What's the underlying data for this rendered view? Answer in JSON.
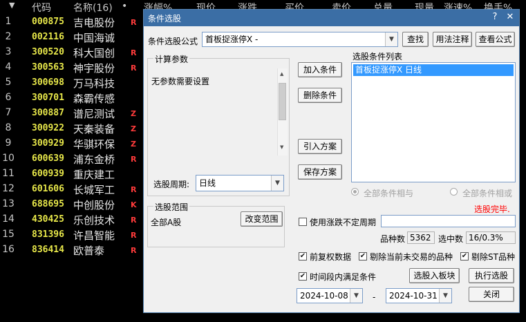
{
  "table": {
    "sort_icon": "▼",
    "headers": [
      "代码",
      "名称(16)",
      "•",
      "涨幅%",
      "现价",
      "涨跌",
      "买价",
      "卖价",
      "总量",
      "现量",
      "涨速%",
      "换手%"
    ],
    "rows": [
      {
        "idx": "1",
        "code": "000875",
        "name": "吉电股份",
        "flag": "R"
      },
      {
        "idx": "2",
        "code": "002116",
        "name": "中国海诚",
        "flag": ""
      },
      {
        "idx": "3",
        "code": "300520",
        "name": "科大国创",
        "flag": "R"
      },
      {
        "idx": "4",
        "code": "300563",
        "name": "神宇股份",
        "flag": "R"
      },
      {
        "idx": "5",
        "code": "300698",
        "name": "万马科技",
        "flag": ""
      },
      {
        "idx": "6",
        "code": "300701",
        "name": "森霸传感",
        "flag": ""
      },
      {
        "idx": "7",
        "code": "300887",
        "name": "谱尼测试",
        "flag": "Z"
      },
      {
        "idx": "8",
        "code": "300922",
        "name": "天秦装备",
        "flag": "Z"
      },
      {
        "idx": "9",
        "code": "300929",
        "name": "华骐环保",
        "flag": "Z"
      },
      {
        "idx": "10",
        "code": "600639",
        "name": "浦东金桥",
        "flag": "R"
      },
      {
        "idx": "11",
        "code": "600939",
        "name": "重庆建工",
        "flag": ""
      },
      {
        "idx": "12",
        "code": "601606",
        "name": "长城军工",
        "flag": "R"
      },
      {
        "idx": "13",
        "code": "688695",
        "name": "中创股份",
        "flag": "K"
      },
      {
        "idx": "14",
        "code": "430425",
        "name": "乐创技术",
        "flag": "R"
      },
      {
        "idx": "15",
        "code": "831396",
        "name": "许昌智能",
        "flag": "R"
      },
      {
        "idx": "16",
        "code": "836414",
        "name": "欧普泰",
        "flag": "R"
      }
    ]
  },
  "dialog": {
    "title": "条件选股",
    "help_icon": "?",
    "close_icon": "✕",
    "formula_label": "条件选股公式",
    "formula_value": "首板捉涨停X  -",
    "find_button": "查找",
    "usage_button": "用法注释",
    "view_button": "查看公式",
    "params_group": "计算参数",
    "params_text": "无参数需要设置",
    "period_label": "选股周期:",
    "period_value": "日线",
    "add_button": "加入条件",
    "delete_button": "删除条件",
    "import_button": "引入方案",
    "save_button": "保存方案",
    "list_title": "选股条件列表",
    "list_items": [
      "首板捉涨停X  日线"
    ],
    "radio_and": "全部条件相与",
    "radio_or": "全部条件相或",
    "status": "选股完毕.",
    "range_group": "选股范围",
    "range_value": "全部A股",
    "change_range_button": "改变范围",
    "uncertain_period_label": "使用涨跌不定周期",
    "stock_count_label": "品种数",
    "stock_count": "5362",
    "selected_label": "选中数",
    "selected_value": "16/0.3%",
    "adjust_label": "前复权数据",
    "exclude_untraded_label": "剔除当前未交易的品种",
    "exclude_st_label": "剔除ST品种",
    "period_satisfy_label": "时间段内满足条件",
    "add_to_board_button": "选股入板块",
    "execute_button": "执行选股",
    "date_from": "2024-10-08",
    "date_sep": "-",
    "date_to": "2024-10-31",
    "close_button": "关闭",
    "checked_mark": "✔"
  }
}
